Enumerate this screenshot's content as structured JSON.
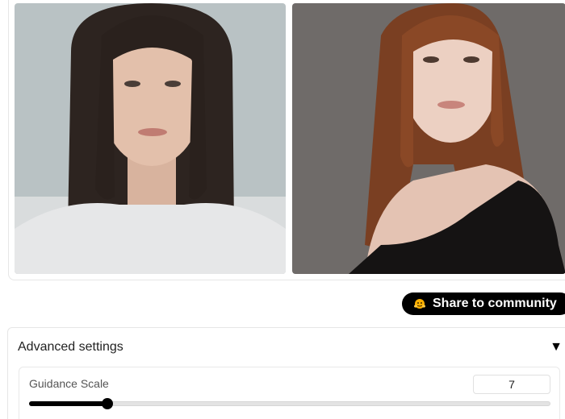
{
  "gallery": {
    "images": [
      {
        "alt": "Portrait of a woman with dark shoulder-length hair on a light gray background"
      },
      {
        "alt": "Portrait of a woman with long auburn hair in a black top on a dark gray background"
      }
    ]
  },
  "share": {
    "label": "Share to community",
    "icon": "hugging-face-icon"
  },
  "advanced": {
    "title": "Advanced settings",
    "caret": "▼",
    "guidance": {
      "label": "Guidance Scale",
      "value": "7",
      "slider_fraction": 0.15
    }
  },
  "colors": {
    "accent": "#000000",
    "track": "#e3e3e3"
  }
}
